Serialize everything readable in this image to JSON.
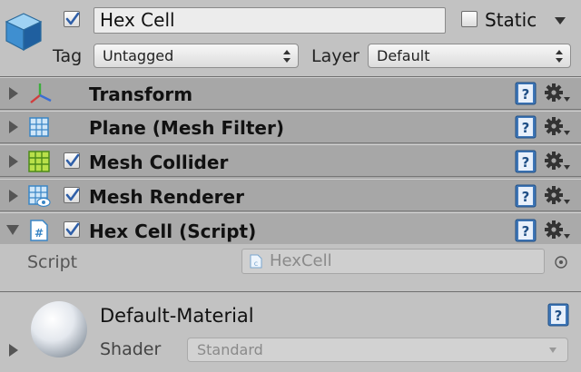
{
  "header": {
    "active": true,
    "name": "Hex Cell",
    "static_label": "Static",
    "static_checked": false,
    "tag_label": "Tag",
    "tag_value": "Untagged",
    "layer_label": "Layer",
    "layer_value": "Default"
  },
  "components": [
    {
      "title": "Transform",
      "icon": "transform-icon",
      "has_checkbox": false,
      "expanded": false
    },
    {
      "title": "Plane (Mesh Filter)",
      "icon": "mesh-filter-icon",
      "has_checkbox": false,
      "expanded": false
    },
    {
      "title": "Mesh Collider",
      "icon": "mesh-collider-icon",
      "has_checkbox": true,
      "checked": true,
      "expanded": false
    },
    {
      "title": "Mesh Renderer",
      "icon": "mesh-renderer-icon",
      "has_checkbox": true,
      "checked": true,
      "expanded": false
    },
    {
      "title": "Hex Cell (Script)",
      "icon": "csharp-script-icon",
      "has_checkbox": true,
      "checked": true,
      "expanded": true
    }
  ],
  "script_field": {
    "label": "Script",
    "value": "HexCell"
  },
  "material": {
    "name": "Default-Material",
    "shader_label": "Shader",
    "shader_value": "Standard"
  },
  "colors": {
    "checkmark": "#2f5fa8",
    "header_bg": "#c2c2c2",
    "component_bg": "#a7a7a7"
  }
}
